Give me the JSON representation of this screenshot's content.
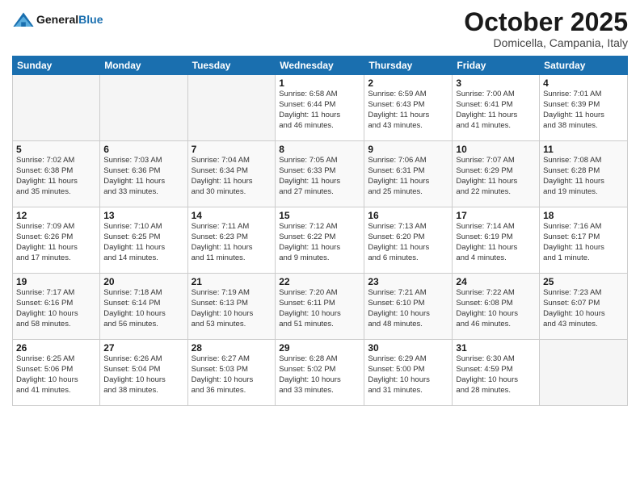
{
  "header": {
    "logo_general": "General",
    "logo_blue": "Blue",
    "month": "October 2025",
    "location": "Domicella, Campania, Italy"
  },
  "weekdays": [
    "Sunday",
    "Monday",
    "Tuesday",
    "Wednesday",
    "Thursday",
    "Friday",
    "Saturday"
  ],
  "weeks": [
    [
      {
        "day": "",
        "info": ""
      },
      {
        "day": "",
        "info": ""
      },
      {
        "day": "",
        "info": ""
      },
      {
        "day": "1",
        "info": "Sunrise: 6:58 AM\nSunset: 6:44 PM\nDaylight: 11 hours\nand 46 minutes."
      },
      {
        "day": "2",
        "info": "Sunrise: 6:59 AM\nSunset: 6:43 PM\nDaylight: 11 hours\nand 43 minutes."
      },
      {
        "day": "3",
        "info": "Sunrise: 7:00 AM\nSunset: 6:41 PM\nDaylight: 11 hours\nand 41 minutes."
      },
      {
        "day": "4",
        "info": "Sunrise: 7:01 AM\nSunset: 6:39 PM\nDaylight: 11 hours\nand 38 minutes."
      }
    ],
    [
      {
        "day": "5",
        "info": "Sunrise: 7:02 AM\nSunset: 6:38 PM\nDaylight: 11 hours\nand 35 minutes."
      },
      {
        "day": "6",
        "info": "Sunrise: 7:03 AM\nSunset: 6:36 PM\nDaylight: 11 hours\nand 33 minutes."
      },
      {
        "day": "7",
        "info": "Sunrise: 7:04 AM\nSunset: 6:34 PM\nDaylight: 11 hours\nand 30 minutes."
      },
      {
        "day": "8",
        "info": "Sunrise: 7:05 AM\nSunset: 6:33 PM\nDaylight: 11 hours\nand 27 minutes."
      },
      {
        "day": "9",
        "info": "Sunrise: 7:06 AM\nSunset: 6:31 PM\nDaylight: 11 hours\nand 25 minutes."
      },
      {
        "day": "10",
        "info": "Sunrise: 7:07 AM\nSunset: 6:29 PM\nDaylight: 11 hours\nand 22 minutes."
      },
      {
        "day": "11",
        "info": "Sunrise: 7:08 AM\nSunset: 6:28 PM\nDaylight: 11 hours\nand 19 minutes."
      }
    ],
    [
      {
        "day": "12",
        "info": "Sunrise: 7:09 AM\nSunset: 6:26 PM\nDaylight: 11 hours\nand 17 minutes."
      },
      {
        "day": "13",
        "info": "Sunrise: 7:10 AM\nSunset: 6:25 PM\nDaylight: 11 hours\nand 14 minutes."
      },
      {
        "day": "14",
        "info": "Sunrise: 7:11 AM\nSunset: 6:23 PM\nDaylight: 11 hours\nand 11 minutes."
      },
      {
        "day": "15",
        "info": "Sunrise: 7:12 AM\nSunset: 6:22 PM\nDaylight: 11 hours\nand 9 minutes."
      },
      {
        "day": "16",
        "info": "Sunrise: 7:13 AM\nSunset: 6:20 PM\nDaylight: 11 hours\nand 6 minutes."
      },
      {
        "day": "17",
        "info": "Sunrise: 7:14 AM\nSunset: 6:19 PM\nDaylight: 11 hours\nand 4 minutes."
      },
      {
        "day": "18",
        "info": "Sunrise: 7:16 AM\nSunset: 6:17 PM\nDaylight: 11 hours\nand 1 minute."
      }
    ],
    [
      {
        "day": "19",
        "info": "Sunrise: 7:17 AM\nSunset: 6:16 PM\nDaylight: 10 hours\nand 58 minutes."
      },
      {
        "day": "20",
        "info": "Sunrise: 7:18 AM\nSunset: 6:14 PM\nDaylight: 10 hours\nand 56 minutes."
      },
      {
        "day": "21",
        "info": "Sunrise: 7:19 AM\nSunset: 6:13 PM\nDaylight: 10 hours\nand 53 minutes."
      },
      {
        "day": "22",
        "info": "Sunrise: 7:20 AM\nSunset: 6:11 PM\nDaylight: 10 hours\nand 51 minutes."
      },
      {
        "day": "23",
        "info": "Sunrise: 7:21 AM\nSunset: 6:10 PM\nDaylight: 10 hours\nand 48 minutes."
      },
      {
        "day": "24",
        "info": "Sunrise: 7:22 AM\nSunset: 6:08 PM\nDaylight: 10 hours\nand 46 minutes."
      },
      {
        "day": "25",
        "info": "Sunrise: 7:23 AM\nSunset: 6:07 PM\nDaylight: 10 hours\nand 43 minutes."
      }
    ],
    [
      {
        "day": "26",
        "info": "Sunrise: 6:25 AM\nSunset: 5:06 PM\nDaylight: 10 hours\nand 41 minutes."
      },
      {
        "day": "27",
        "info": "Sunrise: 6:26 AM\nSunset: 5:04 PM\nDaylight: 10 hours\nand 38 minutes."
      },
      {
        "day": "28",
        "info": "Sunrise: 6:27 AM\nSunset: 5:03 PM\nDaylight: 10 hours\nand 36 minutes."
      },
      {
        "day": "29",
        "info": "Sunrise: 6:28 AM\nSunset: 5:02 PM\nDaylight: 10 hours\nand 33 minutes."
      },
      {
        "day": "30",
        "info": "Sunrise: 6:29 AM\nSunset: 5:00 PM\nDaylight: 10 hours\nand 31 minutes."
      },
      {
        "day": "31",
        "info": "Sunrise: 6:30 AM\nSunset: 4:59 PM\nDaylight: 10 hours\nand 28 minutes."
      },
      {
        "day": "",
        "info": ""
      }
    ]
  ]
}
